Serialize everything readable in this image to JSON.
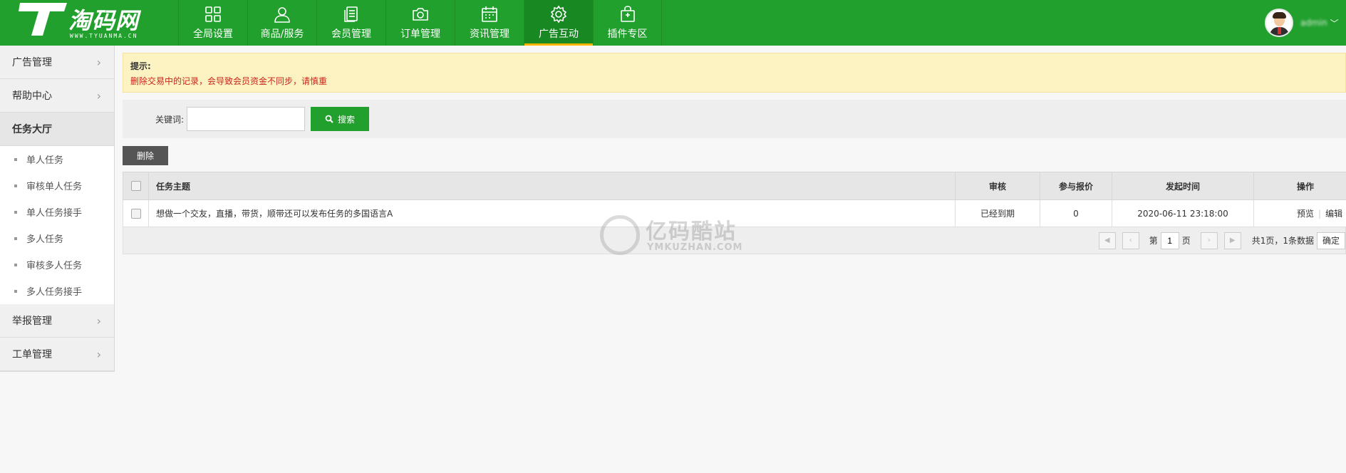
{
  "brand": {
    "name": "淘码网",
    "site": "WWW.TYUANMA.CN"
  },
  "nav": [
    {
      "label": "全局设置",
      "icon": "grid-icon"
    },
    {
      "label": "商品/服务",
      "icon": "user-icon"
    },
    {
      "label": "会员管理",
      "icon": "document-icon"
    },
    {
      "label": "订单管理",
      "icon": "camera-icon"
    },
    {
      "label": "资讯管理",
      "icon": "calendar-icon"
    },
    {
      "label": "广告互动",
      "icon": "gear-icon",
      "active": true
    },
    {
      "label": "插件专区",
      "icon": "bag-icon"
    }
  ],
  "user": {
    "name": "admin",
    "caret": "﹀"
  },
  "sidebar": {
    "groups_top": [
      {
        "label": "广告管理"
      },
      {
        "label": "帮助中心"
      }
    ],
    "open_group": {
      "label": "任务大厅"
    },
    "items": [
      {
        "label": "单人任务"
      },
      {
        "label": "审核单人任务"
      },
      {
        "label": "单人任务接手"
      },
      {
        "label": "多人任务"
      },
      {
        "label": "审核多人任务"
      },
      {
        "label": "多人任务接手"
      }
    ],
    "groups_bottom": [
      {
        "label": "举报管理"
      },
      {
        "label": "工单管理"
      }
    ]
  },
  "tip": {
    "title": "提示:",
    "text": "删除交易中的记录，会导致会员资金不同步，请慎重"
  },
  "search": {
    "label": "关键词:",
    "value": "",
    "placeholder": "",
    "button": "搜索"
  },
  "toolbar": {
    "delete": "删除"
  },
  "table": {
    "headers": {
      "subject": "任务主题",
      "audit": "审核",
      "quote": "参与报价",
      "time": "发起时间",
      "ops": "操作"
    },
    "rows": [
      {
        "subject": "想做一个交友，直播，带货，顺带还可以发布任务的多国语言A",
        "audit": "已经到期",
        "quote": "0",
        "time": "2020-06-11 23:18:00",
        "op_preview": "预览",
        "op_edit": "编辑"
      }
    ]
  },
  "pager": {
    "prefix": "第",
    "page": "1",
    "suffix": "页",
    "total": "共1页，1条数据",
    "ok": "确定"
  },
  "watermark": {
    "cn": "亿码酷站",
    "en": "YMKUZHAN.COM"
  },
  "colors": {
    "primary": "#22a02e",
    "nav_active": "#188823",
    "accent": "#ffb400",
    "warn_text": "#c8261d",
    "tip_bg": "#fdf3c2"
  }
}
